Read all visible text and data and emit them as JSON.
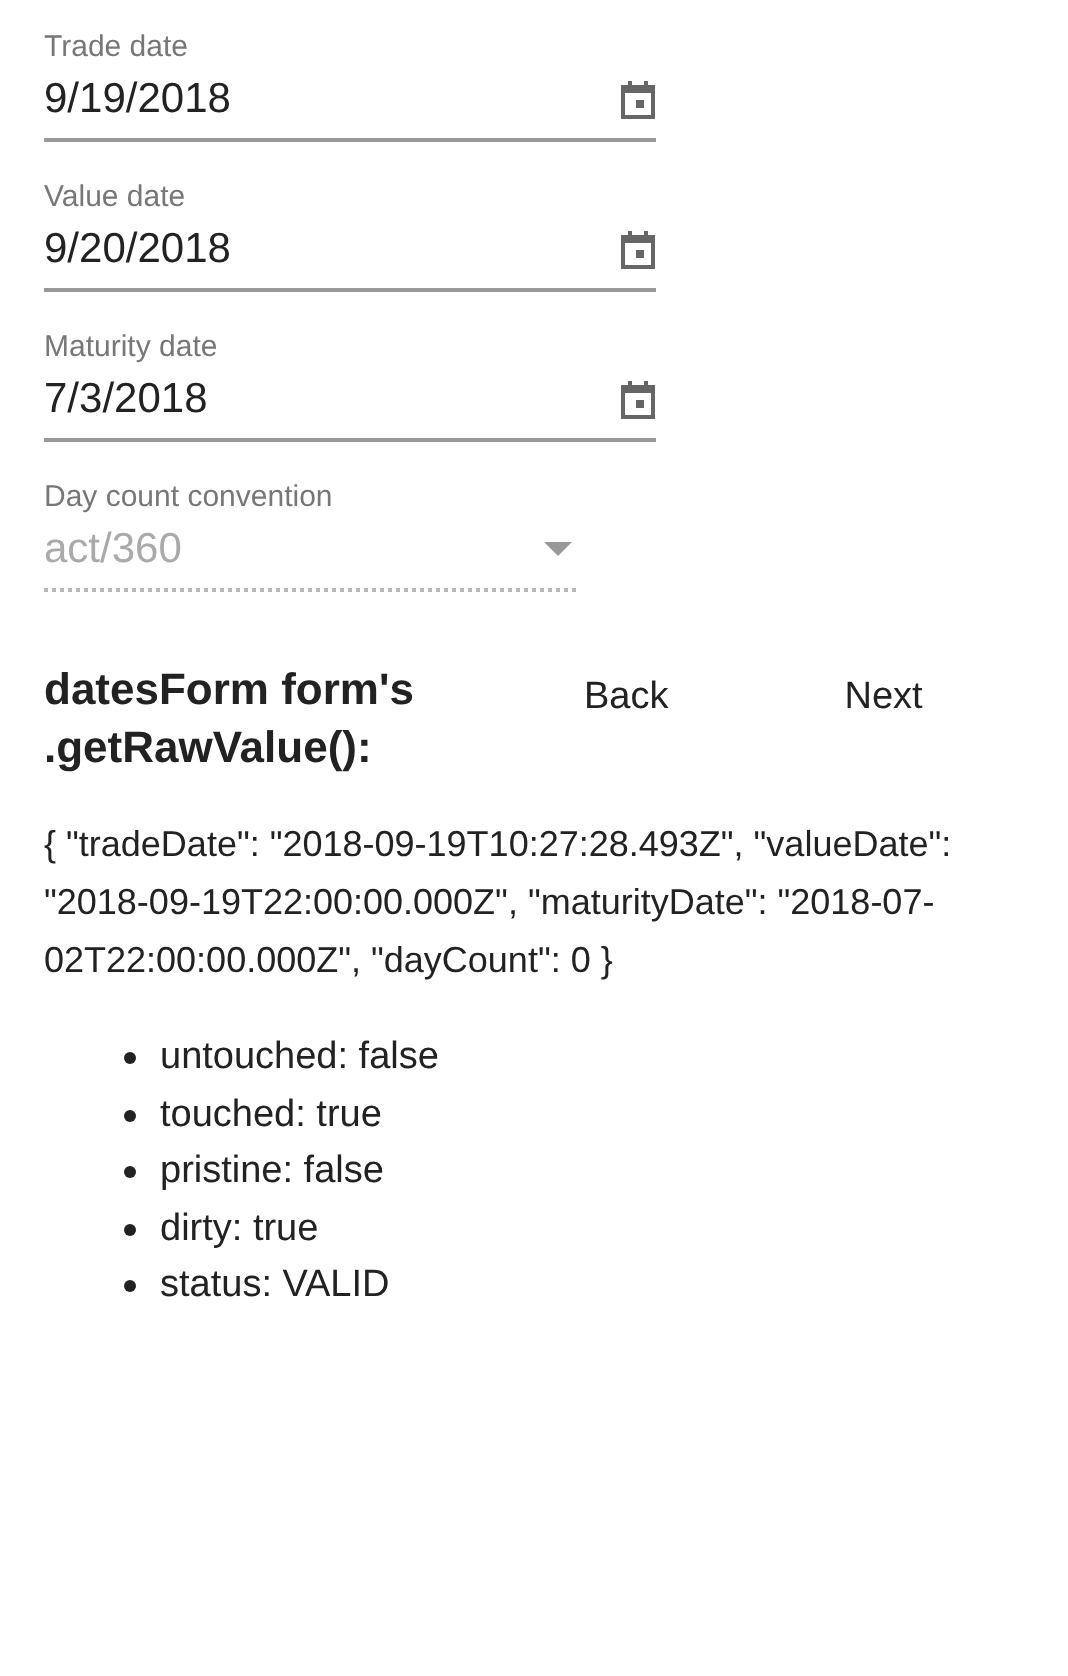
{
  "fields": [
    {
      "kind": "date",
      "label": "Trade date",
      "value": "9/19/2018",
      "disabled": false
    },
    {
      "kind": "date",
      "label": "Value date",
      "value": "9/20/2018",
      "disabled": false
    },
    {
      "kind": "date",
      "label": "Maturity date",
      "value": "7/3/2018",
      "disabled": false
    },
    {
      "kind": "select",
      "label": "Day count convention",
      "value": "act/360",
      "disabled": true
    }
  ],
  "heading": "datesForm form's .getRawValue():",
  "buttons": [
    "Back",
    "Next"
  ],
  "raw_value": "{ \"tradeDate\": \"2018-09-19T10:27:28.493Z\", \"valueDate\": \"2018-09-19T22:00:00.000Z\", \"maturityDate\": \"2018-07-02T22:00:00.000Z\", \"dayCount\": 0 }",
  "status_items": [
    "untouched: false",
    "touched: true",
    "pristine: false",
    "dirty: true",
    "status: VALID"
  ]
}
